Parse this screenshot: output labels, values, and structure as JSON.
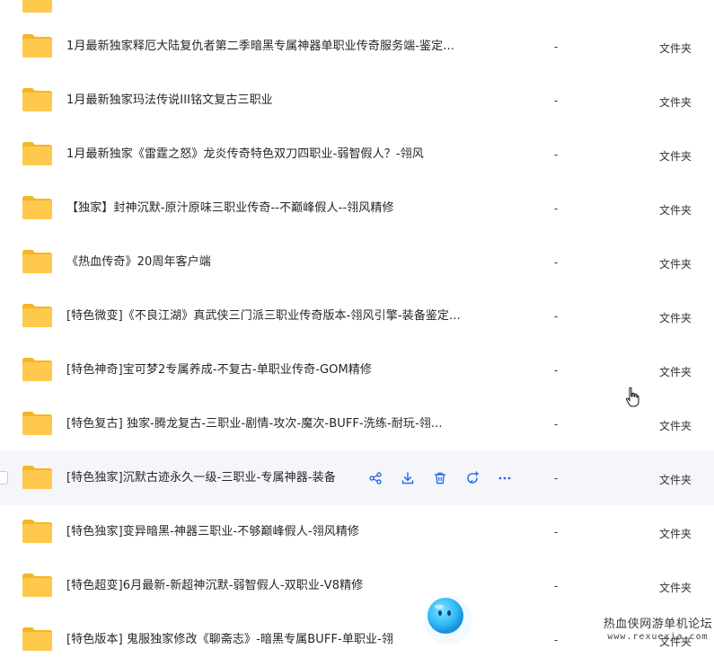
{
  "files": [
    {
      "name": "",
      "size": "",
      "type": ""
    },
    {
      "name": "1月最新独家释厄大陆复仇者第二季暗黑专属神器单职业传奇服务端-鉴定...",
      "size": "-",
      "type": "文件夹"
    },
    {
      "name": "1月最新独家玛法传说III铭文复古三职业",
      "size": "-",
      "type": "文件夹"
    },
    {
      "name": "1月最新独家《雷霆之怒》龙炎传奇特色双刀四职业-弱智假人？-翎风",
      "size": "-",
      "type": "文件夹"
    },
    {
      "name": "【独家】封神沉默-原汁原味三职业传奇--不巅峰假人--翎风精修",
      "size": "-",
      "type": "文件夹"
    },
    {
      "name": "《热血传奇》20周年客户端",
      "size": "-",
      "type": "文件夹"
    },
    {
      "name": "[特色微变]《不良江湖》真武侠三门派三职业传奇版本-翎风引擎-装备鉴定...",
      "size": "-",
      "type": "文件夹"
    },
    {
      "name": "[特色神奇]宝可梦2专属养成-不复古-单职业传奇-GOM精修",
      "size": "-",
      "type": "文件夹"
    },
    {
      "name": "[特色复古] 独家-腾龙复古-三职业-剧情-攻次-魔次-BUFF-洗练-耐玩-翎...",
      "size": "-",
      "type": "文件夹"
    },
    {
      "name": "[特色独家]沉默古迹永久一级-三职业-专属神器-装备",
      "size": "-",
      "type": "文件夹"
    },
    {
      "name": "[特色独家]变异暗黑-神器三职业-不够巅峰假人-翎风精修",
      "size": "-",
      "type": "文件夹"
    },
    {
      "name": "[特色超变]6月最新-新超神沉默-弱智假人-双职业-V8精修",
      "size": "-",
      "type": "文件夹"
    },
    {
      "name": "[特色版本] 鬼服独家修改《聊斋志》-暗黑专属BUFF-单职业-翎",
      "size": "-",
      "type": "文件夹"
    }
  ],
  "row_actions": [
    "share-icon",
    "download-icon",
    "delete-icon",
    "favorite-icon",
    "more-icon"
  ],
  "watermark": {
    "line1": "热血侠网游单机论坛",
    "line2": "www.rexuexia.com"
  },
  "colors": {
    "folder": "#ffc94d",
    "folder_dark": "#f7b523",
    "hover_bg": "#f5f6fa",
    "action": "#2b6de5"
  }
}
